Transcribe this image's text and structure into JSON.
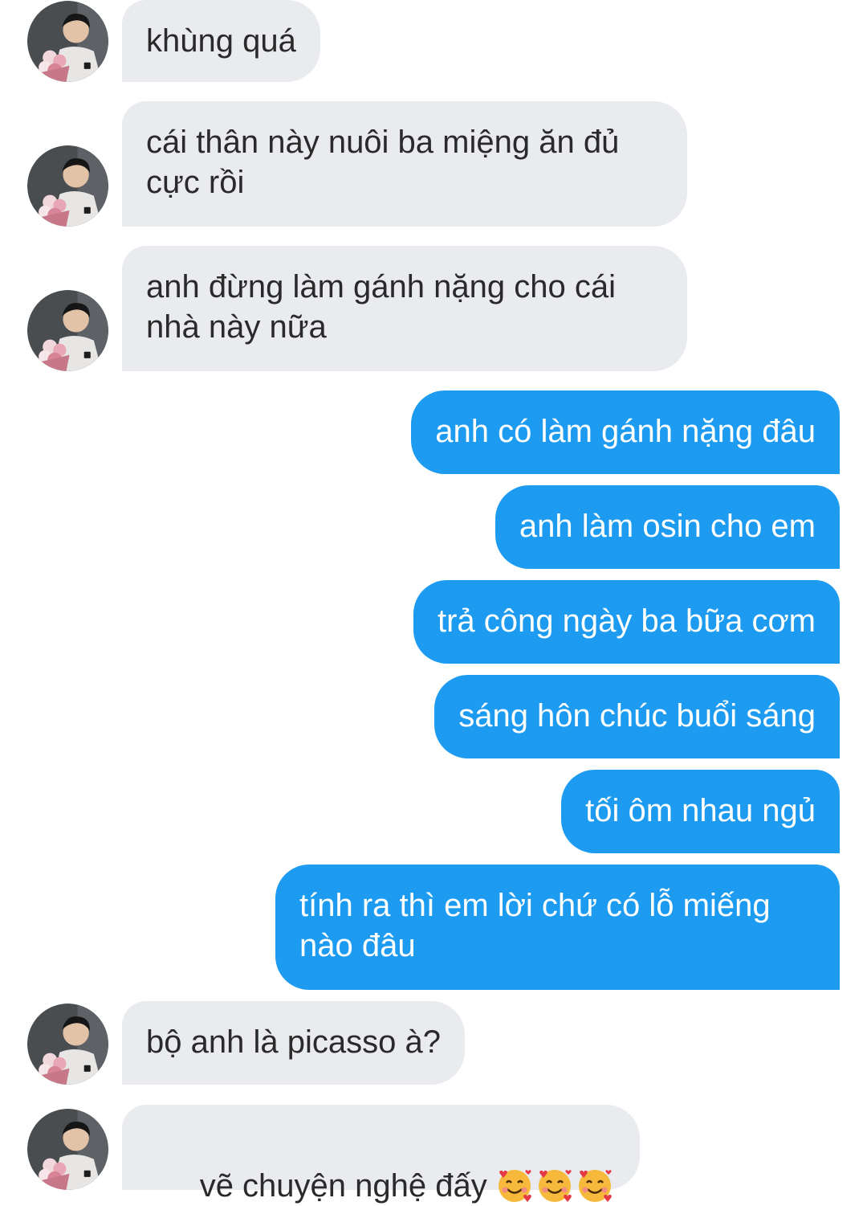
{
  "conversation": {
    "messages": [
      {
        "side": "in",
        "text": "khùng quá"
      },
      {
        "side": "in",
        "text": "cái thân này nuôi ba miệng ăn đủ cực rồi"
      },
      {
        "side": "in",
        "text": "anh đừng làm gánh nặng cho cái nhà này nữa"
      },
      {
        "side": "out",
        "text": "anh có làm gánh nặng đâu"
      },
      {
        "side": "out",
        "text": "anh làm osin cho em"
      },
      {
        "side": "out",
        "text": "trả công ngày ba bữa cơm"
      },
      {
        "side": "out",
        "text": "sáng hôn chúc buổi sáng"
      },
      {
        "side": "out",
        "text": "tối ôm nhau ngủ"
      },
      {
        "side": "out",
        "text": "tính ra thì em lời chứ có lỗ miếng nào đâu"
      },
      {
        "side": "in",
        "text": "bộ anh là picasso à?"
      },
      {
        "side": "in",
        "text": "vẽ chuyện nghệ đấy",
        "emoji": [
          "smiling-face-with-hearts-icon",
          "smiling-face-with-hearts-icon",
          "smiling-face-with-hearts-icon"
        ]
      }
    ]
  },
  "colors": {
    "incoming_bubble": "#e9ebef",
    "outgoing_bubble": "#1d9bf0",
    "incoming_text": "#2a2a2a",
    "outgoing_text": "#ffffff"
  }
}
